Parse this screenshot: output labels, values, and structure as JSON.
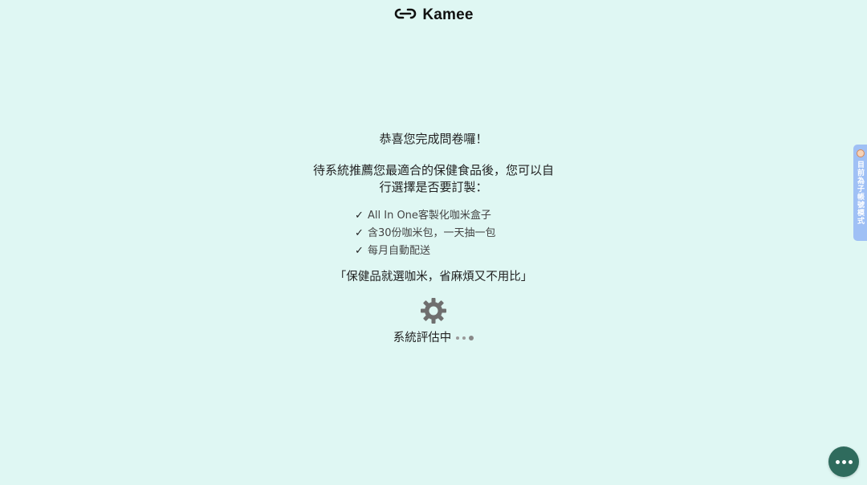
{
  "header": {
    "logo_text": "Kamee",
    "logo_icon": "infinity-link-icon"
  },
  "main": {
    "headline": "恭喜您完成問卷囉！",
    "subtext": "待系統推薦您最適合的保健食品後，您可以自行選擇是否要訂製：",
    "features": [
      "All In One客製化咖米盒子",
      "含30份咖米包，一天抽一包",
      "每月自動配送"
    ],
    "check_symbol": "✓",
    "slogan": "「保健品就選咖米，省麻煩又不用比」",
    "loading_icon": "gear-icon",
    "status_text": "系統評估中"
  },
  "side_tab": {
    "label": "目前為子帳號模式"
  },
  "chat": {
    "icon": "chat-ellipsis-icon"
  },
  "colors": {
    "background": "#dff7f3",
    "chat_button": "#2f6b5d",
    "side_tab": "#9fc0f5"
  }
}
